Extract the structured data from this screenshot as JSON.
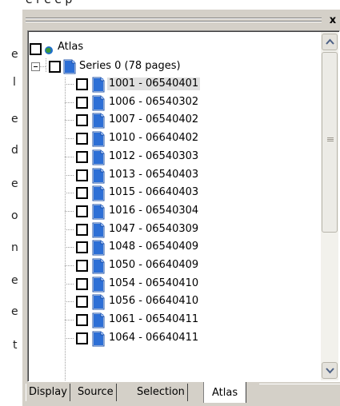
{
  "background": {
    "fragment_top": "e  r   e   e  p",
    "left_letters": [
      "e",
      "l",
      "e",
      "d",
      "e",
      "o",
      "n",
      "e",
      "e",
      "t"
    ]
  },
  "panel": {
    "close_label": "x"
  },
  "tree": {
    "root": {
      "label": "Atlas"
    },
    "series": {
      "label": "Series 0 (78 pages)"
    },
    "pages": [
      "1001 - 06540401",
      "1006 - 06540302",
      "1007 - 06540402",
      "1010 - 06640402",
      "1012 - 06540303",
      "1013 - 06540403",
      "1015 - 06640403",
      "1016 - 06540304",
      "1047 - 06540309",
      "1048 - 06540409",
      "1050 - 06640409",
      "1054 - 06540410",
      "1056 - 06640410",
      "1061 - 06540411",
      "1064 - 06640411"
    ],
    "selected_index": 0
  },
  "tabs": [
    {
      "label": "Display"
    },
    {
      "label": "Source"
    },
    {
      "label": "Selection"
    },
    {
      "label": "Atlas"
    }
  ],
  "active_tab": "Atlas",
  "colors": {
    "panel": "#d4d0c8",
    "selection": "#e0e0e0",
    "doc_icon": "#2d6fd6"
  }
}
